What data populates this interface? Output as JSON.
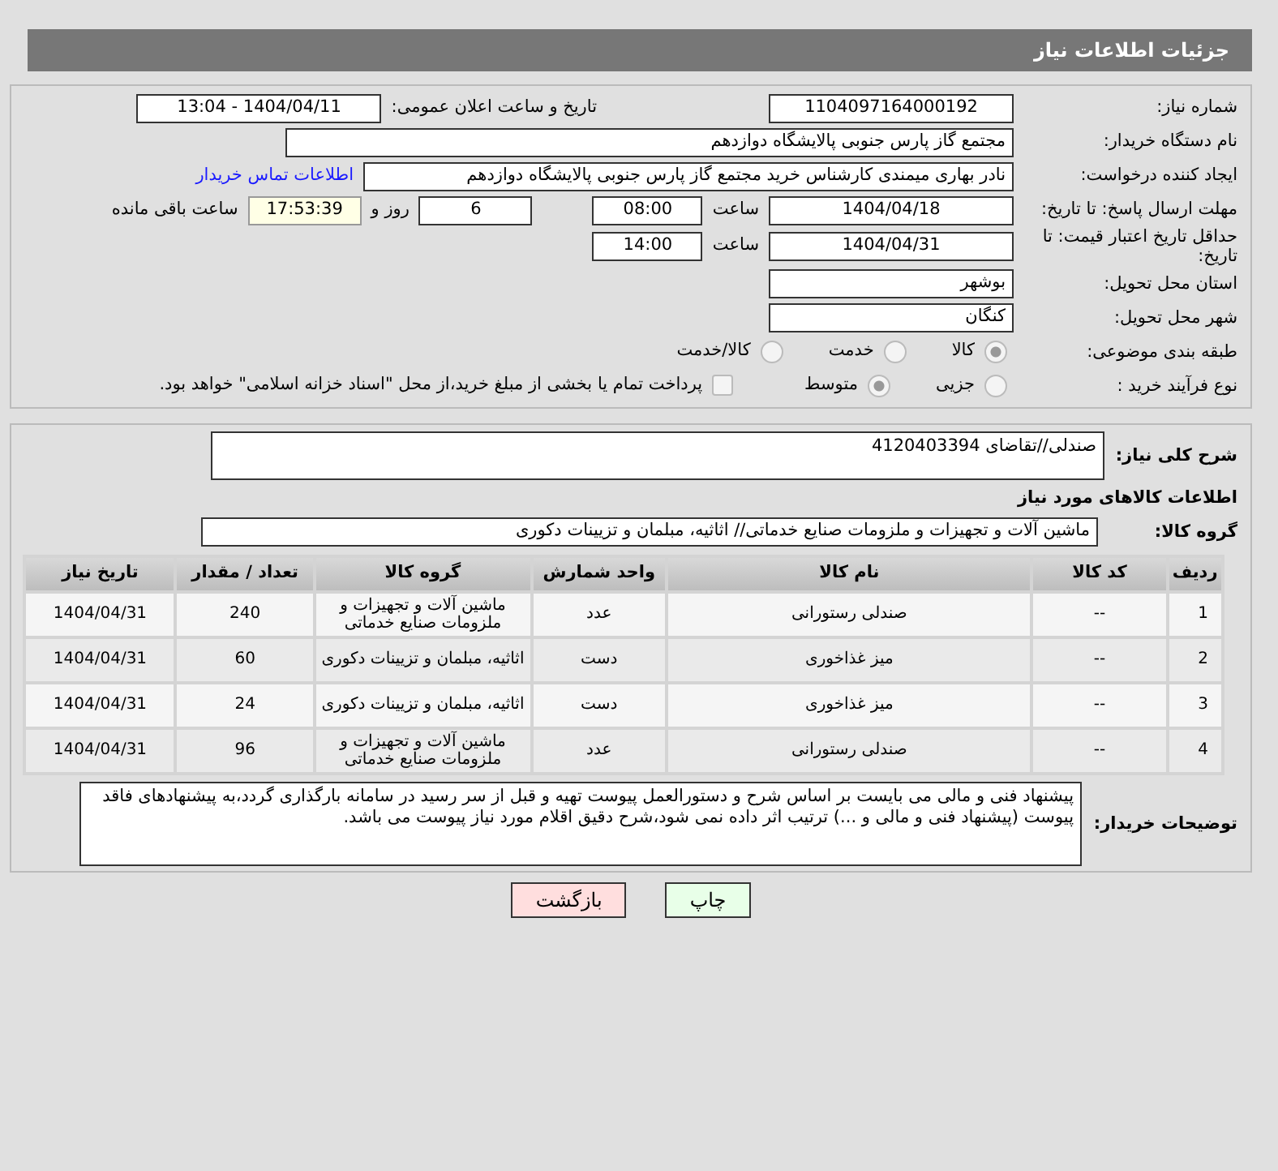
{
  "header": {
    "title": "جزئیات اطلاعات نیاز"
  },
  "need_number": {
    "label": "شماره نیاز:",
    "value": "1104097164000192"
  },
  "announce": {
    "label": "تاریخ و ساعت اعلان عمومی:",
    "value": "1404/04/11 - 13:04"
  },
  "buyer_org": {
    "label": "نام دستگاه خریدار:",
    "value": "مجتمع گاز پارس جنوبی  پالایشگاه دوازدهم"
  },
  "creator": {
    "label": "ایجاد کننده درخواست:",
    "value": "نادر بهاری میمندی کارشناس خرید مجتمع گاز پارس جنوبی  پالایشگاه دوازدهم",
    "link": "اطلاعات تماس خریدار"
  },
  "reply_deadline": {
    "label": "مهلت ارسال پاسخ: تا تاریخ:",
    "date": "1404/04/18",
    "time_label": "ساعت",
    "time": "08:00",
    "days": "6",
    "days_label": "روز و",
    "remaining": "17:53:39",
    "remaining_label": "ساعت باقی مانده"
  },
  "price_validity": {
    "label": "حداقل تاریخ اعتبار قیمت: تا تاریخ:",
    "date": "1404/04/31",
    "time_label": "ساعت",
    "time": "14:00"
  },
  "province": {
    "label": "استان محل تحویل:",
    "value": "بوشهر"
  },
  "city": {
    "label": "شهر محل تحویل:",
    "value": "کنگان"
  },
  "category": {
    "label": "طبقه بندی موضوعی:",
    "options": [
      {
        "label": "کالا",
        "selected": true
      },
      {
        "label": "خدمت",
        "selected": false
      },
      {
        "label": "کالا/خدمت",
        "selected": false
      }
    ]
  },
  "process": {
    "label": "نوع فرآیند خرید :",
    "options": [
      {
        "label": "جزیی",
        "selected": false
      },
      {
        "label": "متوسط",
        "selected": true
      }
    ],
    "treasury": {
      "checked": false,
      "text": "پرداخت تمام یا بخشی از مبلغ خرید،از محل \"اسناد خزانه اسلامی\" خواهد بود."
    }
  },
  "description": {
    "label": "شرح کلی نیاز:",
    "value": "صندلی//تقاضای 4120403394"
  },
  "goods_title": "اطلاعات کالاهای مورد نیاز",
  "goods_group": {
    "label": "گروه کالا:",
    "value": "ماشین آلات و تجهیزات و ملزومات صنایع خدماتی// اثاثیه، مبلمان و تزیینات دکوری"
  },
  "table": {
    "columns": [
      "ردیف",
      "کد کالا",
      "نام کالا",
      "واحد شمارش",
      "گروه کالا",
      "تعداد / مقدار",
      "تاریخ نیاز"
    ],
    "rows": [
      [
        "1",
        "--",
        "صندلی رستورانی",
        "عدد",
        "ماشین آلات و تجهیزات و ملزومات صنایع خدماتی",
        "240",
        "1404/04/31"
      ],
      [
        "2",
        "--",
        "میز غذاخوری",
        "دست",
        "اثاثیه، مبلمان و تزیینات دکوری",
        "60",
        "1404/04/31"
      ],
      [
        "3",
        "--",
        "میز غذاخوری",
        "دست",
        "اثاثیه، مبلمان و تزیینات دکوری",
        "24",
        "1404/04/31"
      ],
      [
        "4",
        "--",
        "صندلی رستورانی",
        "عدد",
        "ماشین آلات و تجهیزات و ملزومات صنایع خدماتی",
        "96",
        "1404/04/31"
      ]
    ]
  },
  "buyer_notes": {
    "label": "توضیحات خریدار:",
    "value": "پیشنهاد فنی و مالی می بایست بر اساس شرح و دستورالعمل پیوست تهیه و قبل از سر رسید در سامانه بارگذاری گردد،به پیشنهادهای فاقد پیوست (پیشنهاد فنی و مالی و ...) ترتیب اثر داده نمی شود،شرح دقیق اقلام مورد نیاز پیوست می باشد."
  },
  "buttons": [
    {
      "label": "چاپ",
      "color": "#e8ffe8"
    },
    {
      "label": "بازگشت",
      "color": "#ffdede"
    }
  ]
}
